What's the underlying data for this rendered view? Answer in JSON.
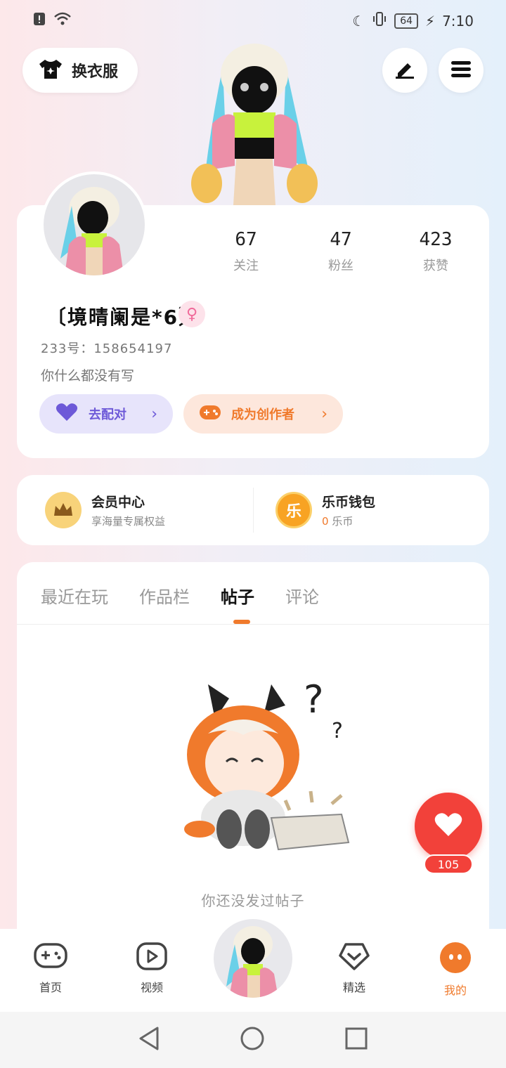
{
  "status_bar": {
    "time": "7:10",
    "battery": "64"
  },
  "header": {
    "outfit_label": "换衣服"
  },
  "profile": {
    "stats": [
      {
        "value": "67",
        "label": "关注"
      },
      {
        "value": "47",
        "label": "粉丝"
      },
      {
        "value": "423",
        "label": "获赞"
      }
    ],
    "nickname": "〔境晴阑是*6〕",
    "uid": "233号：158654197",
    "bio": "你什么都没有写",
    "match_label": "去配对",
    "creator_label": "成为创作者"
  },
  "member": {
    "vip_title": "会员中心",
    "vip_sub": "享海量专属权益",
    "wallet_icon": "乐",
    "wallet_title": "乐币钱包",
    "wallet_amount": "0",
    "wallet_unit": "乐币"
  },
  "tabs": [
    "最近在玩",
    "作品栏",
    "帖子",
    "评论"
  ],
  "empty_text": "你还没发过帖子",
  "fab": {
    "count": "105"
  },
  "bottom_nav": [
    {
      "label": "首页"
    },
    {
      "label": "视频"
    },
    {
      "label": "精选"
    },
    {
      "label": "我的"
    }
  ],
  "colors": {
    "accent": "#f07a2c",
    "heart": "#f2413a",
    "match": "#6d59d8"
  }
}
